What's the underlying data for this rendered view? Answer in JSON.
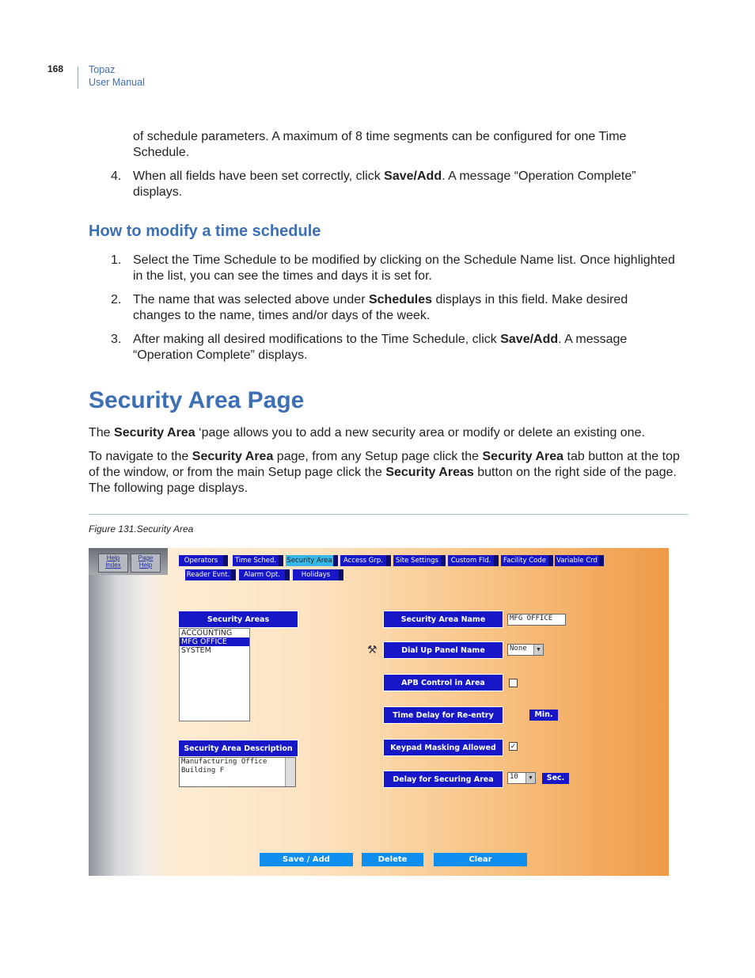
{
  "header": {
    "page_number": "168",
    "product": "Topaz",
    "doc": "User Manual"
  },
  "intro_continuation": "of schedule parameters. A maximum of 8 time segments can be configured for one Time Schedule.",
  "step4": {
    "num": "4.",
    "pre": "When all fields have been set correctly, click ",
    "bold": "Save/Add",
    "post": ". A message “Operation Complete” displays."
  },
  "modify": {
    "heading": "How to modify a time schedule",
    "steps": [
      {
        "num": "1.",
        "pre": "Select the Time Schedule to be modified by clicking on the Schedule Name list. Once highlighted in the list, you can see the times and days it is set for.",
        "bold": "",
        "post": ""
      },
      {
        "num": "2.",
        "pre": "The name that was selected above under ",
        "bold": "Schedules",
        "post": " displays in this field. Make desired changes to the name, times and/or days of the week."
      },
      {
        "num": "3.",
        "pre": "After making all desired modifications to the Time Schedule, click ",
        "bold": "Save/Add",
        "post": ". A message “Operation Complete” displays."
      }
    ]
  },
  "section": {
    "heading": "Security Area Page",
    "p1": {
      "a": "The ",
      "b": "Security Area",
      "c": " ‘page allows you to add a new security area or modify or delete an existing one."
    },
    "p2": {
      "a": "To navigate to the ",
      "b": "Security Area",
      "c": " page, from any Setup page click the ",
      "d": "Security Area",
      "e": " tab button at the top of the window, or from the main Setup page click the ",
      "f": "Security Areas",
      "g": " button on the right side of the page. The following page displays."
    }
  },
  "figure": {
    "caption": "Figure 131.Security Area",
    "help_buttons": [
      "Help Index",
      "Page Help"
    ],
    "tabs_row1": [
      "Operators",
      "Time Sched.",
      "Security Area",
      "Access Grp.",
      "Site Settings",
      "Custom Fld.",
      "Facility Code",
      "Variable Crd"
    ],
    "tabs_row2": [
      "Reader Evnt.",
      "Alarm Opt.",
      "Holidays"
    ],
    "active_tab": "Security Area",
    "security_areas_label": "Security Areas",
    "security_areas": [
      "ACCOUNTING",
      "MFG OFFICE",
      "SYSTEM"
    ],
    "selected_area": "MFG OFFICE",
    "description_label": "Security Area Description",
    "description_lines": [
      "Manufacturing Office",
      "Building F"
    ],
    "fields": {
      "name_label": "Security Area Name",
      "name_value": "MFG OFFICE",
      "dialup_label": "Dial Up Panel Name",
      "dialup_value": "None",
      "apb_label": "APB Control in Area",
      "apb_checked": false,
      "delay_label": "Time Delay for Re-entry",
      "delay_unit": "Min.",
      "keypad_label": "Keypad Masking Allowed",
      "keypad_checked": true,
      "securing_label": "Delay for Securing Area",
      "securing_value": "10",
      "securing_unit": "Sec."
    },
    "actions": [
      "Save / Add",
      "Delete",
      "Clear"
    ]
  }
}
